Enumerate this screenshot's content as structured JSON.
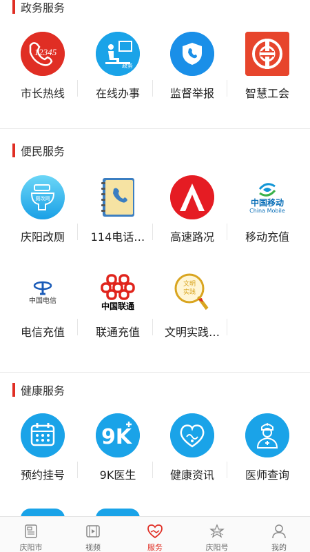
{
  "sections": [
    {
      "title": "政务服务",
      "items": [
        {
          "label": "市长热线",
          "icon": "hotline-12345-icon"
        },
        {
          "label": "在线办事",
          "icon": "online-affairs-icon",
          "badge": "政务"
        },
        {
          "label": "监督举报",
          "icon": "phone-shield-icon"
        },
        {
          "label": "智慧工会",
          "icon": "trade-union-icon"
        }
      ]
    },
    {
      "title": "便民服务",
      "items": [
        {
          "label": "庆阳改厕",
          "icon": "toilet-icon",
          "badge": "厕改网"
        },
        {
          "label": "114电话…",
          "icon": "phonebook-icon"
        },
        {
          "label": "高速路况",
          "icon": "highway-icon"
        },
        {
          "label": "移动充值",
          "icon": "china-mobile-logo",
          "line1": "中国移动",
          "line2": "China Mobile"
        },
        {
          "label": "电信充值",
          "icon": "china-telecom-logo",
          "line1": "中国电信"
        },
        {
          "label": "联通充值",
          "icon": "china-unicom-logo",
          "line1": "中国联通"
        },
        {
          "label": "文明实践…",
          "icon": "civilization-practice-icon",
          "badge": "文明实践"
        }
      ]
    },
    {
      "title": "健康服务",
      "items": [
        {
          "label": "预约挂号",
          "icon": "calendar-icon"
        },
        {
          "label": "9K医生",
          "icon": "9k-doctor-icon",
          "badge": "9K"
        },
        {
          "label": "健康资讯",
          "icon": "heart-health-icon"
        },
        {
          "label": "医师查询",
          "icon": "doctor-icon"
        }
      ]
    }
  ],
  "tabbar": {
    "items": [
      {
        "label": "庆阳市",
        "icon": "news-icon",
        "active": false
      },
      {
        "label": "视频",
        "icon": "video-icon",
        "active": false
      },
      {
        "label": "服务",
        "icon": "service-heart-icon",
        "active": true
      },
      {
        "label": "庆阳号",
        "icon": "star-icon",
        "active": false
      },
      {
        "label": "我的",
        "icon": "user-icon",
        "active": false
      }
    ]
  },
  "colors": {
    "accent": "#e02e24",
    "blue": "#1aa3e8"
  }
}
